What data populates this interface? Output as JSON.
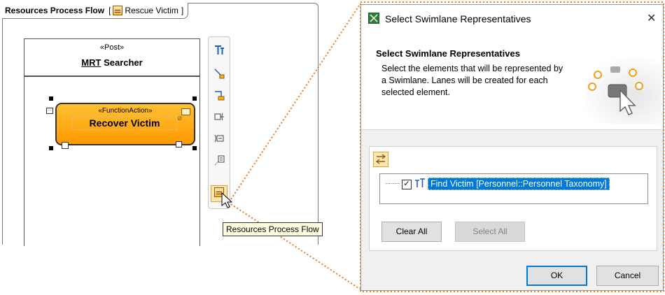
{
  "diagram": {
    "frame_title": "Resources Process Flow",
    "frame_context_open": "[",
    "frame_context": "Rescue Victim",
    "frame_context_close": "]",
    "swimlane": {
      "stereotype": "«Post»",
      "name_prefix": "MRT",
      "name_rest": " Searcher"
    },
    "action": {
      "stereotype": "«FunctionAction»",
      "name": "Recover Victim"
    },
    "tooltip": "Resources Process Flow"
  },
  "dialog": {
    "title": "Select Swimlane Representatives",
    "close_glyph": "✕",
    "header_title": "Select Swimlane Representatives",
    "header_description": "Select the elements that will be represented by a Swimlane. Lanes will be created for each selected element.",
    "tree_item": {
      "label": "Find Victim [Personnel::Personnel Taxonomy]",
      "checked": true
    },
    "clear_all_label": "Clear All",
    "select_all_label": "Select All",
    "ok_label": "OK",
    "cancel_label": "Cancel"
  },
  "colors": {
    "action_fill": "#ff9800",
    "selection": "#0078d7",
    "dotted_connector": "#f07a1a"
  }
}
